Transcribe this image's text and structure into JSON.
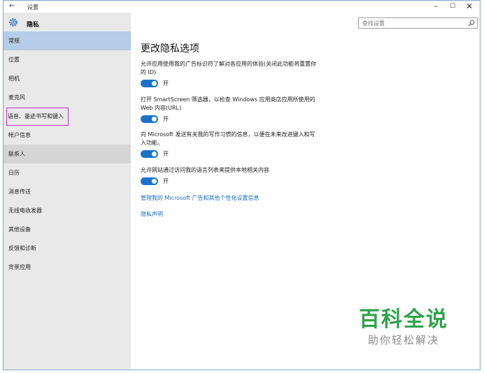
{
  "window": {
    "title": "设置",
    "back_glyph": "←",
    "min_glyph": "–",
    "max_glyph": "☐",
    "close_glyph": "✕"
  },
  "sidebar": {
    "header_title": "隐私",
    "header_icon": "gear-icon",
    "items": [
      {
        "label": "常规",
        "state": "selected"
      },
      {
        "label": "位置"
      },
      {
        "label": "相机"
      },
      {
        "label": "麦克风"
      },
      {
        "label": "语音、墨迹书写和键入",
        "state": "highlighted"
      },
      {
        "label": "帐户信息"
      },
      {
        "label": "联系人",
        "state": "hover"
      },
      {
        "label": "日历"
      },
      {
        "label": "消息传送"
      },
      {
        "label": "无线电收发器"
      },
      {
        "label": "其他设备"
      },
      {
        "label": "反馈和诊断"
      },
      {
        "label": "背景应用"
      }
    ]
  },
  "search": {
    "placeholder": "查找设置",
    "icon": "search-icon"
  },
  "main": {
    "title": "更改隐私选项",
    "settings": [
      {
        "description": "允许应用使用我的广告标识符了解对各应用的体验(关闭此功能将重置你的 ID)",
        "toggle_state": "开",
        "on": true
      },
      {
        "description": "打开 SmartScreen 筛选器，以检查 Windows 应用商店应用所使用的 Web 内容(URL)",
        "toggle_state": "开",
        "on": true
      },
      {
        "description": "向 Microsoft 发送有关我的写作习惯的信息，以便在未来改进键入和写入功能。",
        "toggle_state": "开",
        "on": true
      },
      {
        "description": "允许网站通过访问我的语言列表来提供本地相关内容",
        "toggle_state": "开",
        "on": true
      }
    ],
    "links": [
      "管理我的 Microsoft 广告和其他个性化设置信息",
      "隐私声明"
    ]
  },
  "watermark": {
    "main": "百科全说",
    "sub": "助你轻松解决"
  },
  "colors": {
    "accent": "#1a73c9",
    "selected_bg": "#b5cde6",
    "highlight_outline": "#c430c4",
    "watermark_green": "#2ea24a"
  }
}
